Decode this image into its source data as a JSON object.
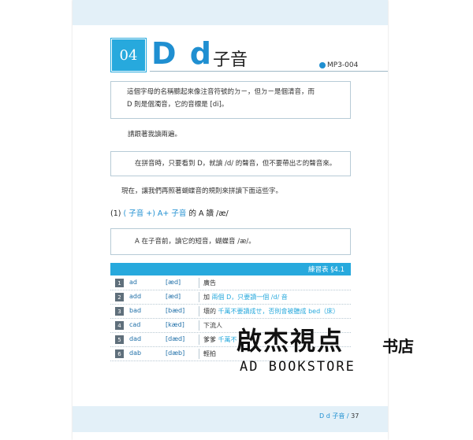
{
  "header": {
    "number": "04",
    "letters": "D d",
    "title_cn": "子音",
    "audio": "MP3-004"
  },
  "intro": {
    "line1": "這個字母的名稱聽起來像注音符號的ㄉㄧ，但ㄉㄧ是個清音，而",
    "line2": "D 則是個濁音，它的音標是 [di]。"
  },
  "follow": "請跟著我讀兩遍。",
  "tip": "在拼音時，只要看到 D，就讀 /d/ 的聲音，但不要帶出ㄜ的聲音來。",
  "now": "現在，讓我們再照著蝴蝶音的規則來拼讀下面這些字。",
  "section": {
    "prefix": "(1)",
    "formula": "( 子音 +) A+ 子音",
    "suffix": "的 A 讀 /æ/"
  },
  "rule": "A 在子音前，讀它的短音，蝴蝶音 /æ/。",
  "table": {
    "title": "練習表 §4.1",
    "rows": [
      {
        "n": "1",
        "word": "ad",
        "ipa": "[æd]",
        "pre": "廣告",
        "hl": "",
        "post": ""
      },
      {
        "n": "2",
        "word": "add",
        "ipa": "[æd]",
        "pre": "加 ",
        "hl": "兩個 D，只要讀一個 /d/ 音",
        "post": ""
      },
      {
        "n": "3",
        "word": "bad",
        "ipa": "[bæd]",
        "pre": "壞的 ",
        "hl": "千萬不要讀成ㄝ，否則會被聽成 bed（床）",
        "post": ""
      },
      {
        "n": "4",
        "word": "cad",
        "ipa": "[kæd]",
        "pre": "下流人",
        "hl": "",
        "post": ""
      },
      {
        "n": "5",
        "word": "dad",
        "ipa": "[dæd]",
        "pre": "爹爹 ",
        "hl": "千萬不",
        "post": ""
      },
      {
        "n": "6",
        "word": "dab",
        "ipa": "[dæb]",
        "pre": "輕拍",
        "hl": "",
        "post": ""
      }
    ]
  },
  "footer": {
    "label": "D d 子音",
    "page": "37"
  },
  "watermark": {
    "cn": "啟杰視点",
    "cn_small": "书店",
    "en": "AD BOOKSTORE"
  }
}
